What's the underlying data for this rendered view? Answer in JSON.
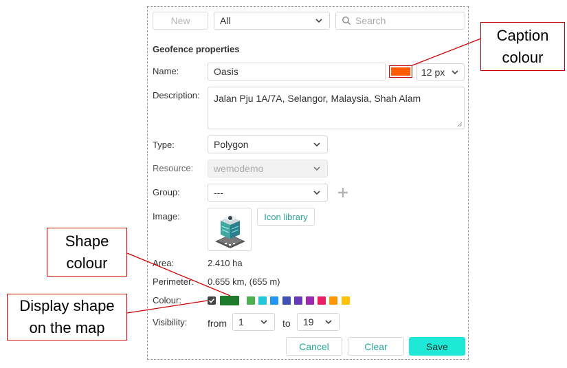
{
  "toolbar": {
    "new_label": "New",
    "filter_value": "All",
    "search_placeholder": "Search"
  },
  "properties": {
    "section_title": "Geofence properties",
    "name": {
      "label": "Name:",
      "value": "Oasis",
      "caption_colour": "#ff5a00",
      "font_size": "12 px"
    },
    "description": {
      "label": "Description:",
      "value": "Jalan Pju 1A/7A, Selangor, Malaysia, Shah Alam"
    },
    "type": {
      "label": "Type:",
      "value": "Polygon"
    },
    "resource": {
      "label": "Resource:",
      "value": "wemodemo"
    },
    "group": {
      "label": "Group:",
      "value": "---"
    },
    "image": {
      "label": "Image:",
      "icon_library_label": "Icon library",
      "icon": "building-icon"
    },
    "area": {
      "label": "Area:",
      "value": "2.410 ha"
    },
    "perimeter": {
      "label": "Perimeter:",
      "value": "0.655 km, (655 m)"
    },
    "colour": {
      "label": "Colour:",
      "display_shape_checked": true,
      "selected": "#1e7b2c",
      "palette": [
        "#4caf50",
        "#26c6da",
        "#2196f3",
        "#3f51b5",
        "#673ab7",
        "#9c27b0",
        "#e91e63",
        "#ff9800",
        "#ffc107"
      ]
    },
    "visibility": {
      "label": "Visibility:",
      "from_label": "from",
      "from_value": "1",
      "to_label": "to",
      "to_value": "19"
    }
  },
  "actions": {
    "cancel_label": "Cancel",
    "clear_label": "Clear",
    "save_label": "Save"
  },
  "callouts": {
    "caption_colour": [
      "Caption",
      "colour"
    ],
    "shape_colour": [
      "Shape",
      "colour"
    ],
    "display_shape": [
      "Display shape",
      "on the map"
    ]
  }
}
